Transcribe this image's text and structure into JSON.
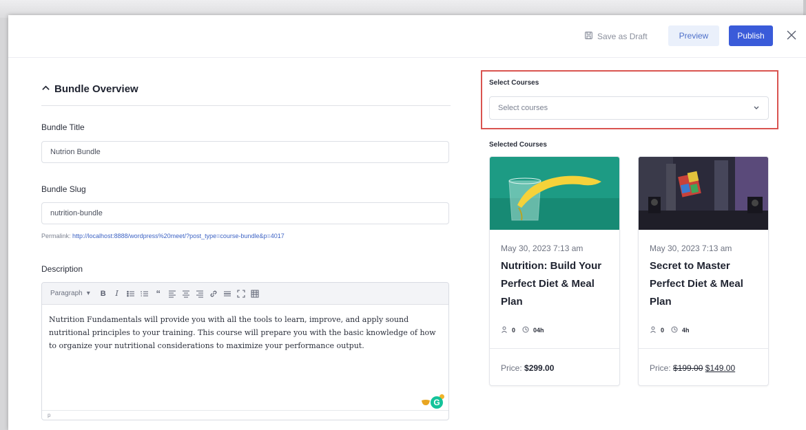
{
  "toolbar": {
    "save_draft_label": "Save as Draft",
    "preview_label": "Preview",
    "publish_label": "Publish"
  },
  "overview": {
    "title": "Bundle Overview",
    "bundle_title_label": "Bundle Title",
    "bundle_title_value": "Nutrion Bundle",
    "bundle_slug_label": "Bundle Slug",
    "bundle_slug_value": "nutrition-bundle",
    "permalink_label": "Permalink:",
    "permalink_url": "http://localhost:8888/wordpress%20meet/?post_type=course-bundle&p=4017",
    "description_label": "Description",
    "editor_format": "Paragraph",
    "editor_text": "Nutrition Fundamentals will provide you with all the tools to learn, improve, and apply sound nutritional principles to your training. This course will prepare you with the basic knowledge of how to organize your nutritional considerations to maximize your performance output.",
    "editor_status": "p"
  },
  "courses": {
    "select_label": "Select Courses",
    "select_placeholder": "Select courses",
    "selected_label": "Selected Courses",
    "items": [
      {
        "date": "May 30, 2023 7:13 am",
        "title": "Nutrition: Build Your Perfect Diet & Meal Plan",
        "students": "0",
        "duration": "04h",
        "price_label": "Price:",
        "price": "$299.00"
      },
      {
        "date": "May 30, 2023 7:13 am",
        "title": "Secret to Master Perfect Diet & Meal Plan",
        "students": "0",
        "duration": "4h",
        "price_label": "Price:",
        "old_price": "$199.00",
        "price": "$149.00"
      }
    ]
  },
  "colors": {
    "accent": "#3a5bd9",
    "highlight_box": "#d9534f",
    "preview_bg": "#eaf0fb"
  }
}
